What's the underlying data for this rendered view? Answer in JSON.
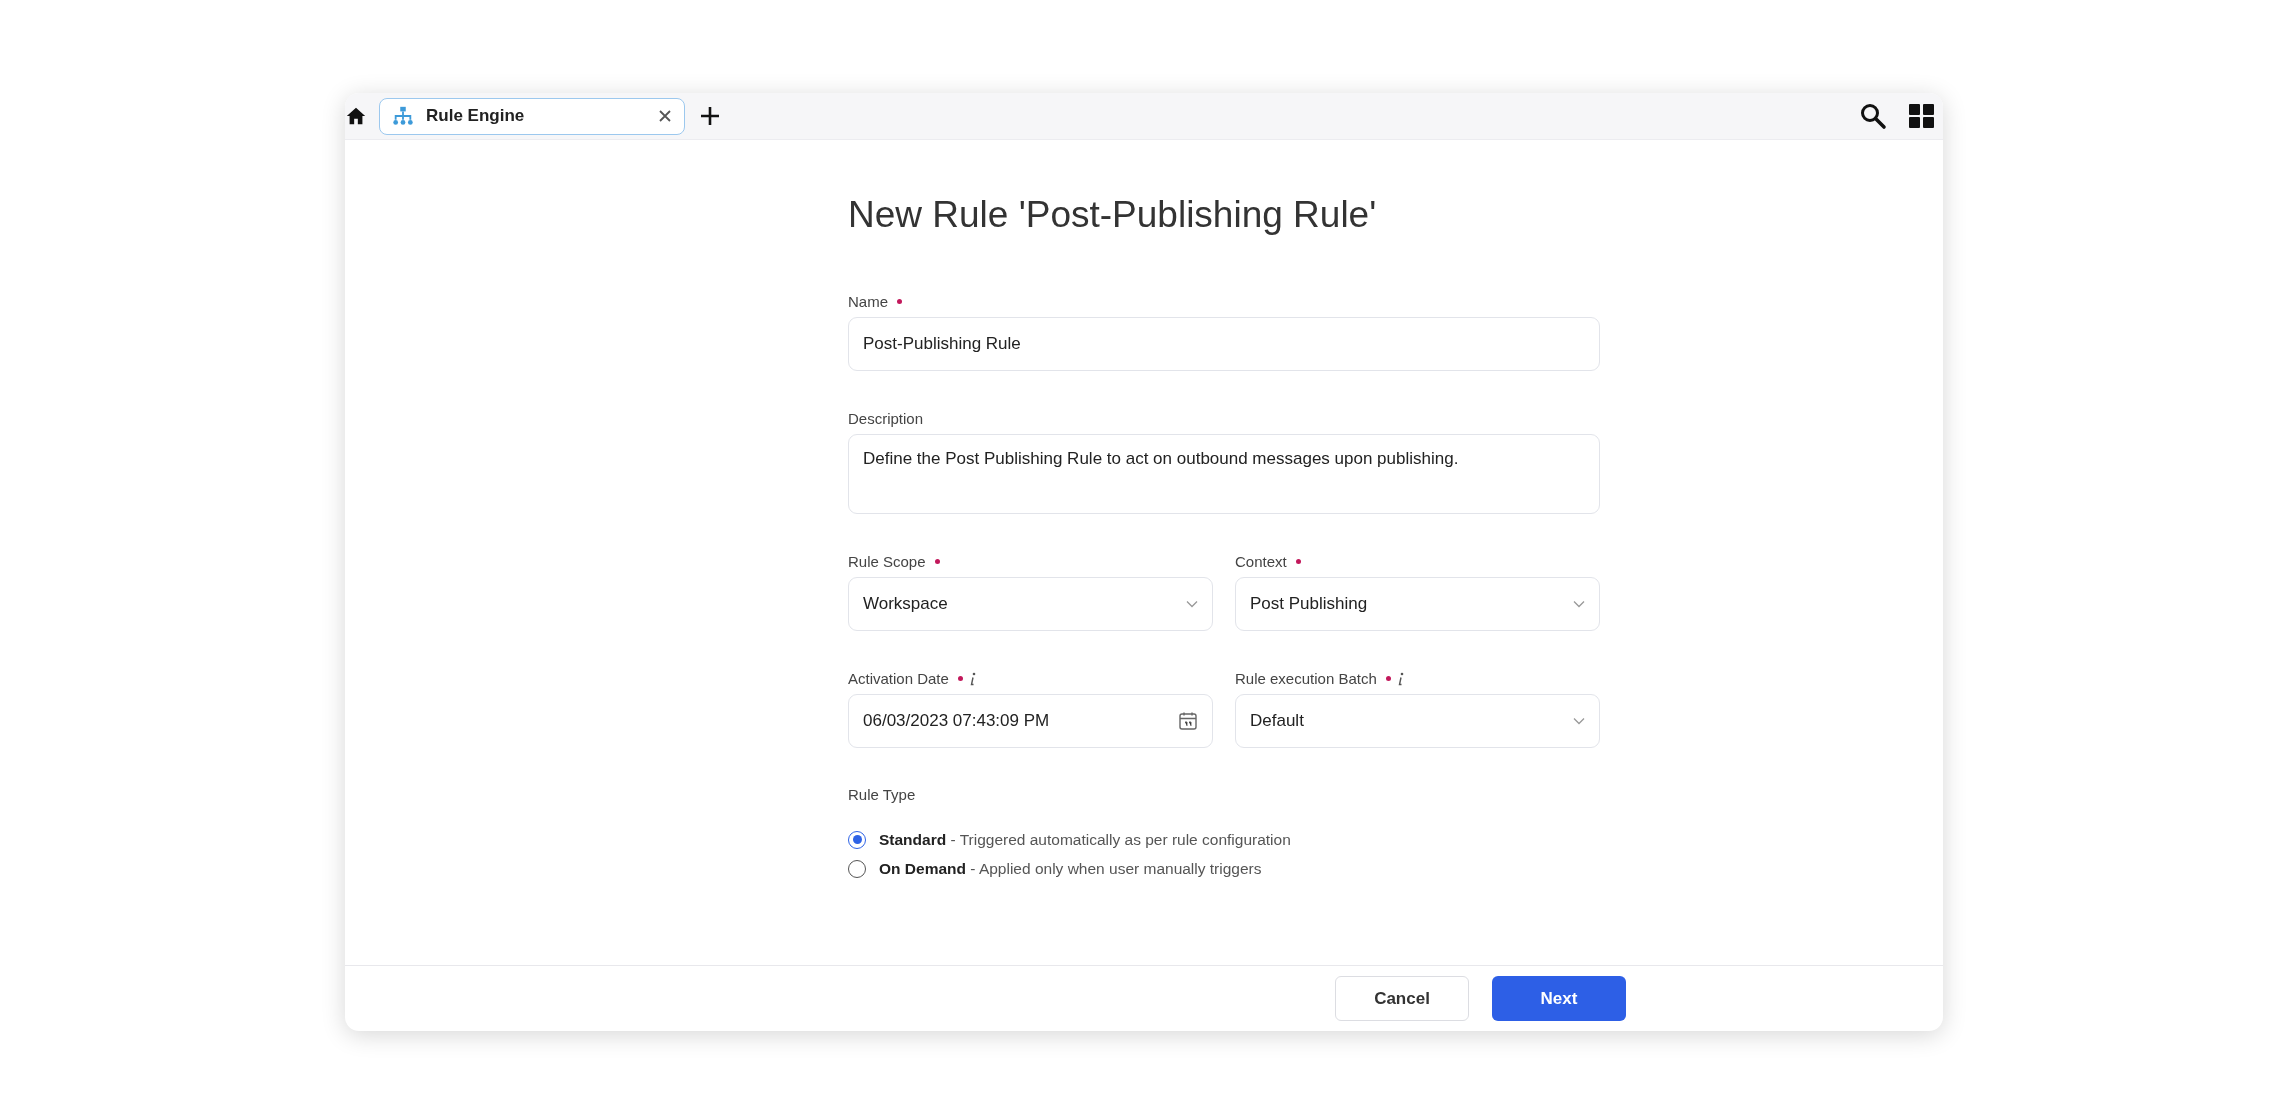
{
  "tabs": [
    {
      "label": "Rule Engine",
      "selected": true
    }
  ],
  "title": "New Rule 'Post-Publishing Rule'",
  "fields": [
    {
      "kind": "text",
      "label": "Name",
      "required": true,
      "info": false,
      "value": "Post-Publishing Rule"
    },
    {
      "kind": "textarea",
      "label": "Description",
      "required": false,
      "info": false,
      "value": "Define the Post Publishing Rule to act on outbound messages upon publishing."
    },
    {
      "kind": "select",
      "label": "Rule Scope",
      "required": true,
      "info": false,
      "value": "Workspace"
    },
    {
      "kind": "select",
      "label": "Context",
      "required": true,
      "info": false,
      "value": "Post Publishing"
    },
    {
      "kind": "date",
      "label": "Activation Date",
      "required": true,
      "info": true,
      "value": "06/03/2023 07:43:09 PM"
    },
    {
      "kind": "select",
      "label": "Rule execution Batch",
      "required": true,
      "info": true,
      "value": "Default"
    }
  ],
  "rule_type": {
    "label": "Rule Type",
    "options": [
      {
        "text": "**Standard** - Triggered automatically as per rule configuration",
        "selected": true
      },
      {
        "text": "**On Demand** - Applied only when user manually triggers",
        "selected": false
      }
    ]
  },
  "buttons": [
    {
      "kind": "secondary",
      "label": "Cancel"
    },
    {
      "kind": "primary",
      "label": "Next"
    }
  ]
}
